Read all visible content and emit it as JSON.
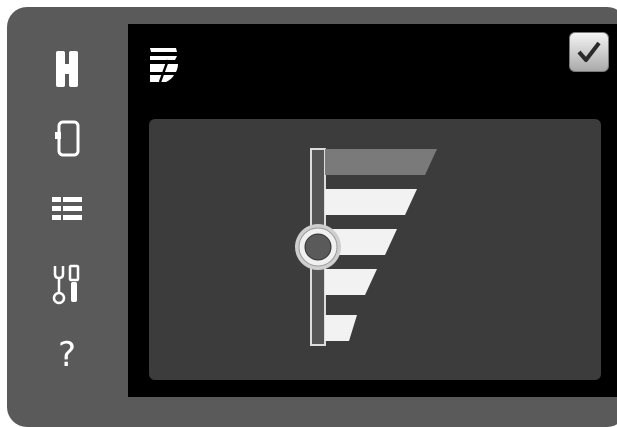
{
  "sidebar": {
    "items": [
      {
        "icon": "home-icon"
      },
      {
        "icon": "phone-icon"
      },
      {
        "icon": "list-icon"
      },
      {
        "icon": "tools-icon"
      },
      {
        "icon": "help-icon",
        "glyph": "?"
      }
    ]
  },
  "header": {
    "mode_icon": "fan-speed-icon",
    "confirm_icon": "checkmark-icon"
  },
  "level_control": {
    "level_fraction": 0.5,
    "steps": 5,
    "active_step": 5,
    "colors": {
      "active_bar": "#7a7a7a",
      "inactive_bar": "#f2f2f2",
      "track": "#555555",
      "knob": "#5a5a5a"
    }
  }
}
